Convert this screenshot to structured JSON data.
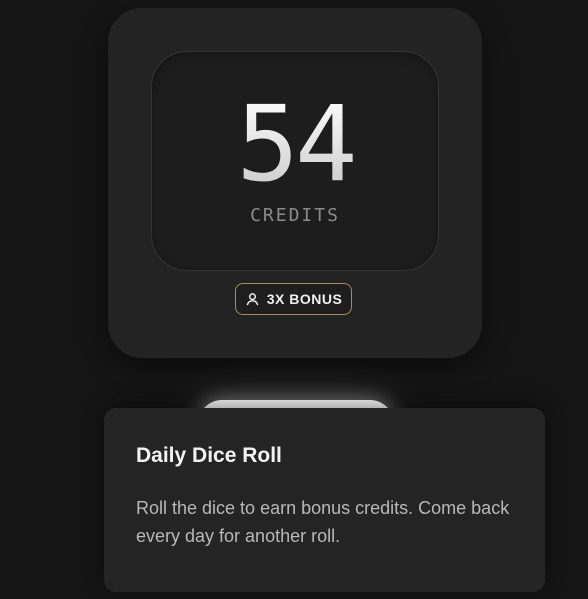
{
  "credits_card": {
    "value": "54",
    "label": "CREDITS",
    "bonus_badge": {
      "icon": "user-icon",
      "label": "3X BONUS",
      "border_color": "#a58b62"
    }
  },
  "roll_button": {
    "label": ""
  },
  "info_popover": {
    "title": "Daily Dice Roll",
    "description": "Roll the dice to earn bonus credits. Come back every day for another roll."
  },
  "colors": {
    "background": "#151515",
    "card": "#232323",
    "panel": "#1d1d1d",
    "popover": "#242424"
  }
}
